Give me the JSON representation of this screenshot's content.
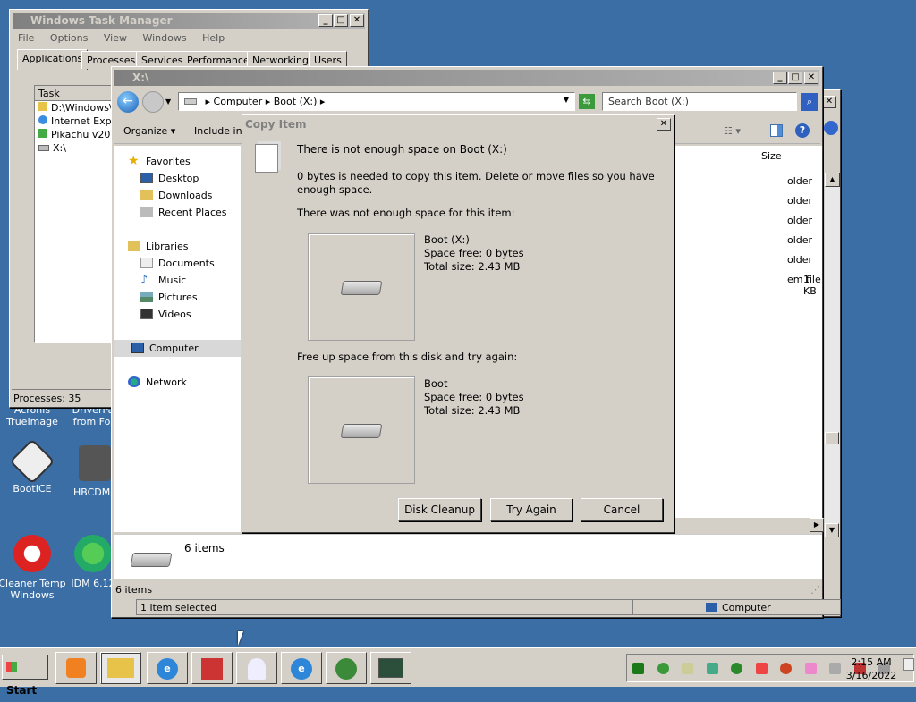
{
  "desktop": {
    "icons": [
      {
        "label": "Acronis\nTrueImage",
        "icon": "acronis-icon"
      },
      {
        "label": "DriverPa\nfrom Fol",
        "icon": "driverpack-icon"
      },
      {
        "label": "BootICE",
        "icon": "bootice-icon"
      },
      {
        "label": "HBCDMe",
        "icon": "hbcdmenu-icon"
      },
      {
        "label": "Cleaner Temp\nWindows",
        "icon": "ccleaner-icon"
      },
      {
        "label": "IDM 6.12",
        "icon": "idm-icon"
      }
    ]
  },
  "taskmgr": {
    "title": "Windows Task Manager",
    "menu": [
      "File",
      "Options",
      "View",
      "Windows",
      "Help"
    ],
    "tabs": [
      "Applications",
      "Processes",
      "Services",
      "Performance",
      "Networking",
      "Users"
    ],
    "column": "Task",
    "tasks": [
      "D:\\Windows\\",
      "Internet Exp",
      "Pikachu v201",
      "X:\\"
    ],
    "status": "Processes: 35"
  },
  "explorer": {
    "title": "X:\\",
    "breadcrumb": [
      "Computer",
      "Boot (X:)"
    ],
    "search_placeholder": "Search Boot (X:)",
    "toolbar": {
      "organize": "Organize",
      "include": "Include in l"
    },
    "nav": {
      "favorites": "Favorites",
      "favorites_items": [
        "Desktop",
        "Downloads",
        "Recent Places"
      ],
      "libraries": "Libraries",
      "libraries_items": [
        "Documents",
        "Music",
        "Pictures",
        "Videos"
      ],
      "computer": "Computer",
      "network": "Network"
    },
    "column_size": "Size",
    "files": [
      {
        "type": "older",
        "size": ""
      },
      {
        "type": "older",
        "size": ""
      },
      {
        "type": "older",
        "size": ""
      },
      {
        "type": "older",
        "size": ""
      },
      {
        "type": "older",
        "size": ""
      },
      {
        "type": "em file",
        "size": "1 KB"
      }
    ],
    "details_count": "6 items",
    "status_items": "6 items",
    "status_selected": "1 item selected",
    "status_location": "Computer"
  },
  "dialog": {
    "title": "Copy Item",
    "heading": "There is not enough space on Boot (X:)",
    "message": "0 bytes is needed to copy this item. Delete or move files so you have enough space.",
    "item_label": "There was not enough space for this item:",
    "item": {
      "name": "Boot (X:)",
      "free": "Space free: 0 bytes",
      "total": "Total size: 2.43 MB"
    },
    "free_label": "Free up space from this disk and try again:",
    "disk": {
      "name": "Boot",
      "free": "Space free: 0 bytes",
      "total": "Total size: 2.43 MB"
    },
    "buttons": {
      "cleanup": "Disk Cleanup",
      "retry": "Try Again",
      "cancel": "Cancel"
    }
  },
  "taskbar": {
    "start": "Start",
    "time": "2:15 AM",
    "date": "3/16/2022"
  }
}
